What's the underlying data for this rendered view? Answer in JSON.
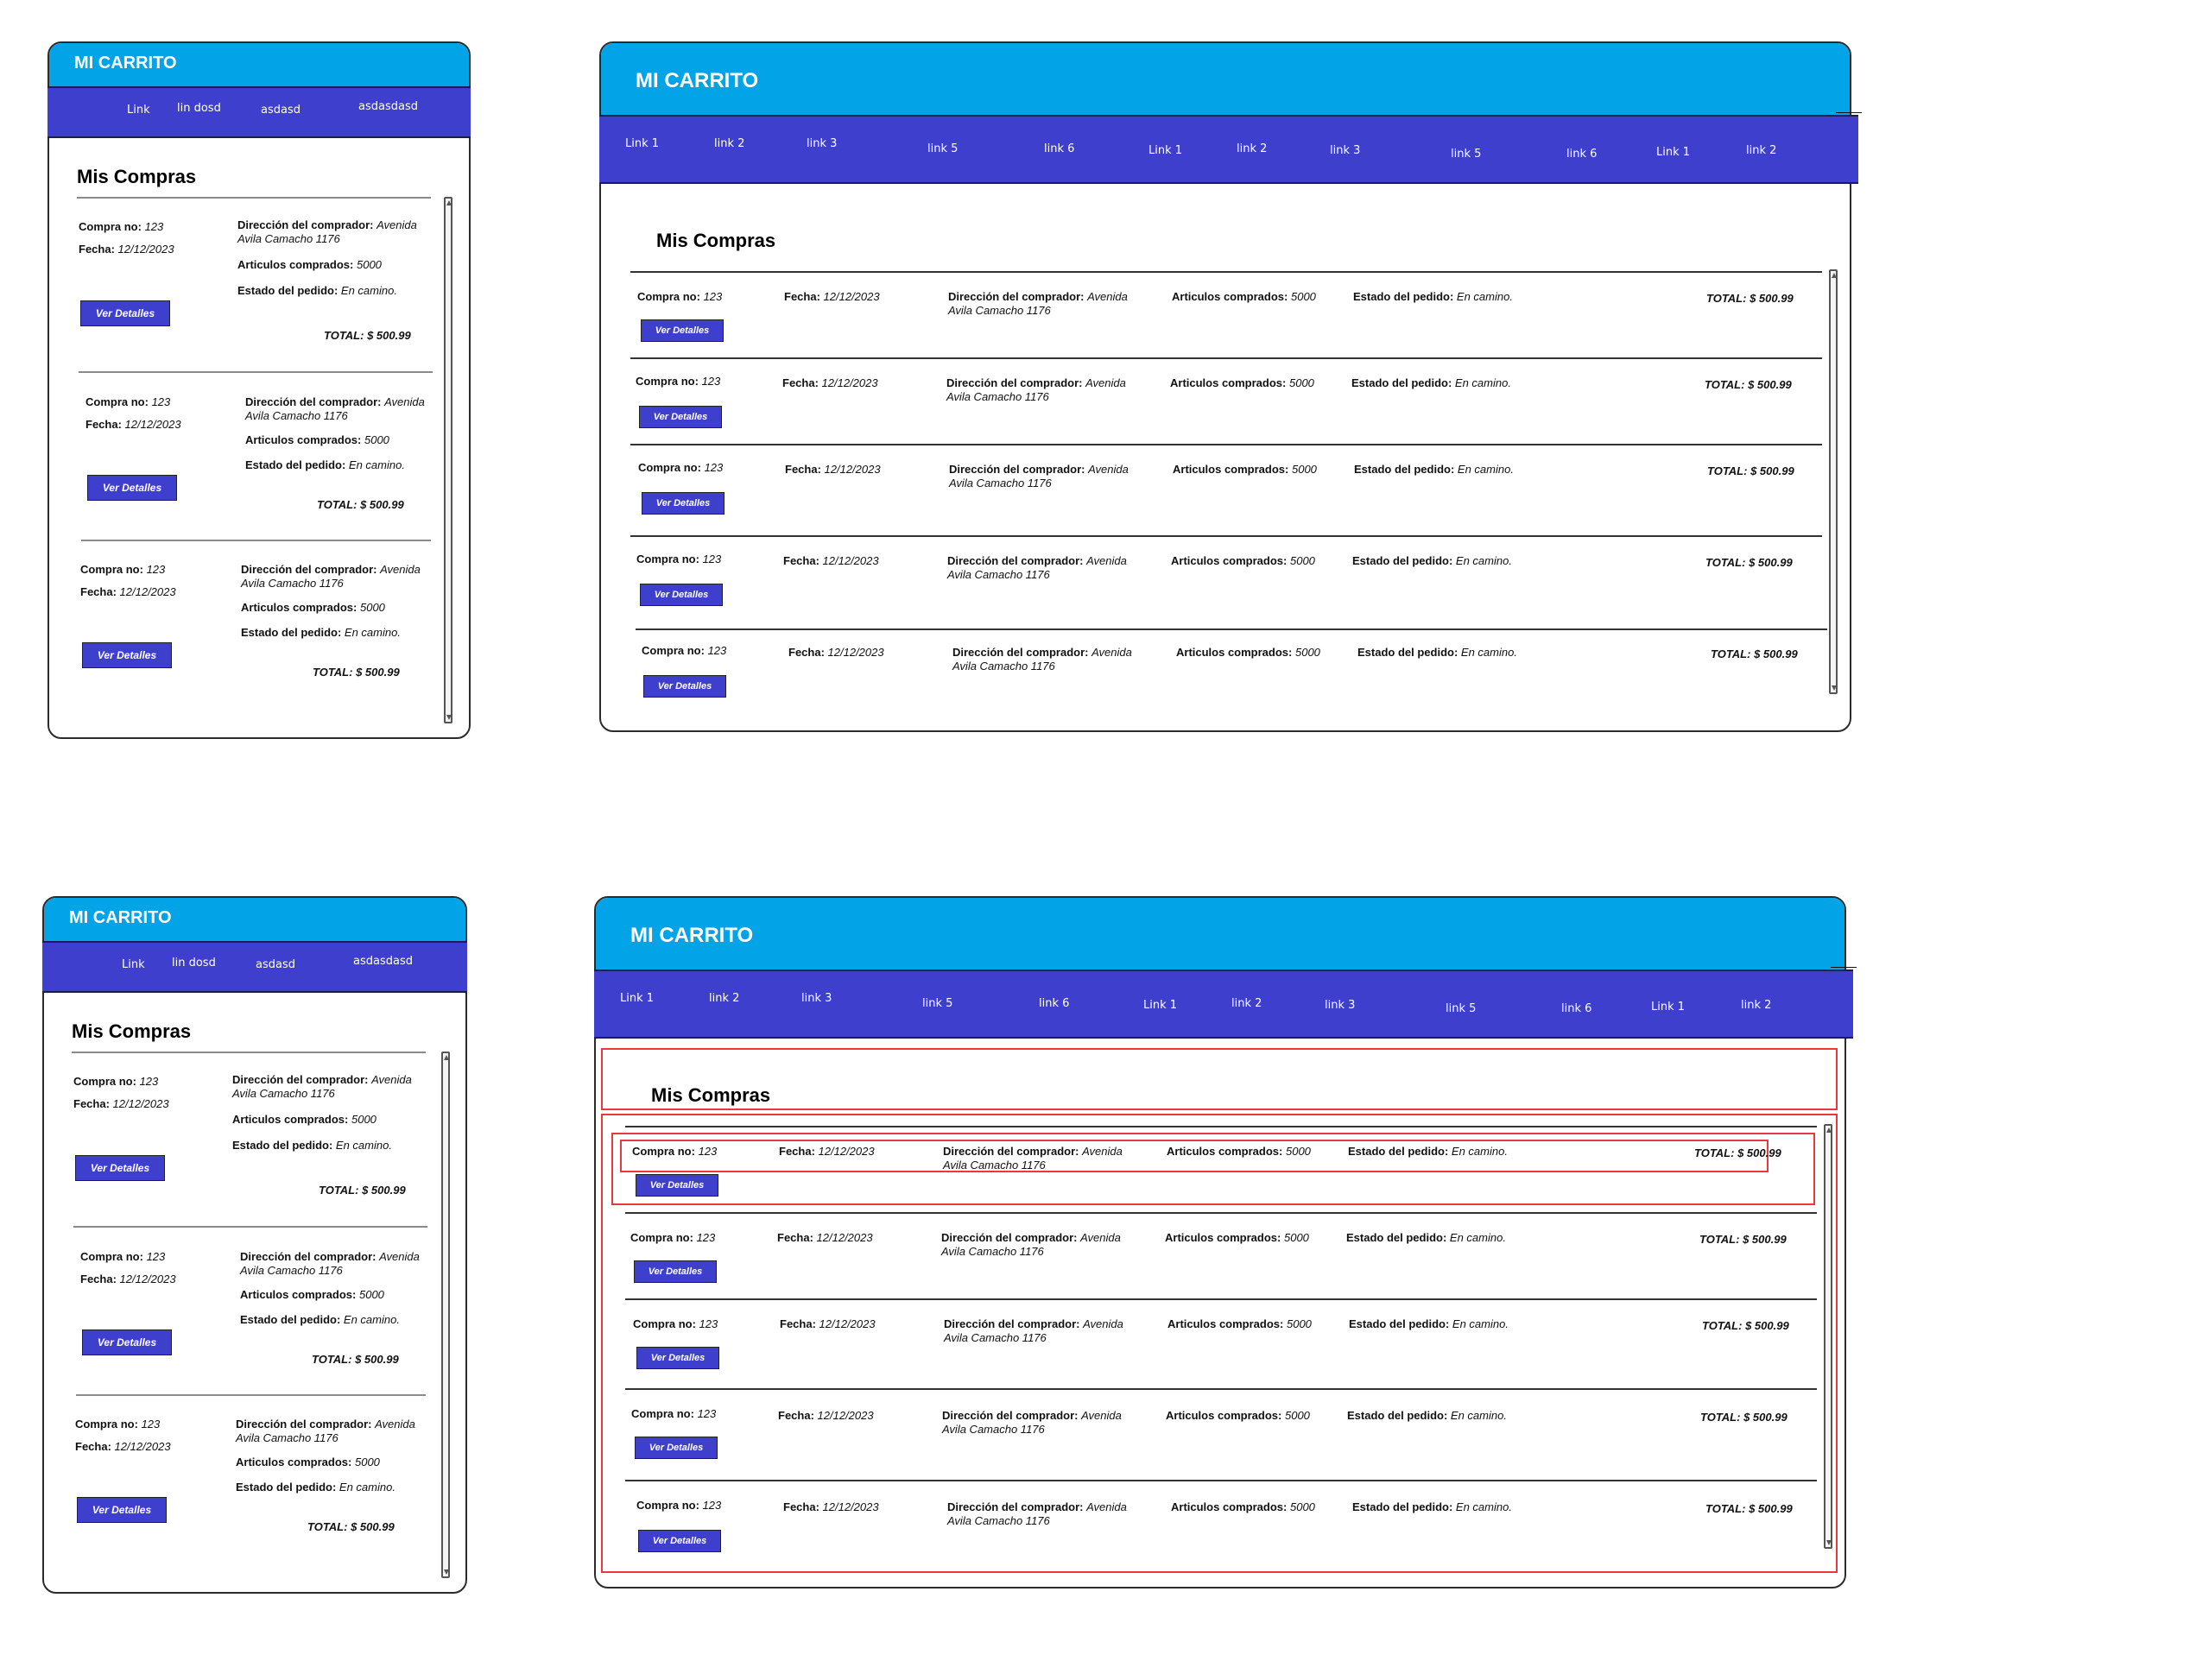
{
  "app_title": "MI CARRITO",
  "section_title": "Mis Compras",
  "nav_small": [
    "Link",
    "lin dosd",
    "asdasd",
    "asdasdasd"
  ],
  "nav_large": [
    "Link 1",
    "link 2",
    "link 3",
    "link 5",
    "link 6",
    "Link 1",
    "link 2",
    "link 3",
    "link 5",
    "link 6",
    "Link 1",
    "link 2"
  ],
  "order": {
    "compra_label": "Compra no:",
    "compra_value": "123",
    "fecha_label": "Fecha:",
    "fecha_value": "12/12/2023",
    "direccion_label": "Dirección del comprador:",
    "direccion_value_1": "Avenida",
    "direccion_value_2": "Avila Camacho 1176",
    "articulos_label": "Articulos comprados:",
    "articulos_value": "5000",
    "estado_label": "Estado del pedido:",
    "estado_value": "En camino.",
    "total": "TOTAL: $ 500.99",
    "button": "Ver Detalles"
  },
  "colors": {
    "header": "#03a3e7",
    "nav": "#3e3fcc",
    "button": "#3e3fcc",
    "highlight": "#e8393f"
  }
}
